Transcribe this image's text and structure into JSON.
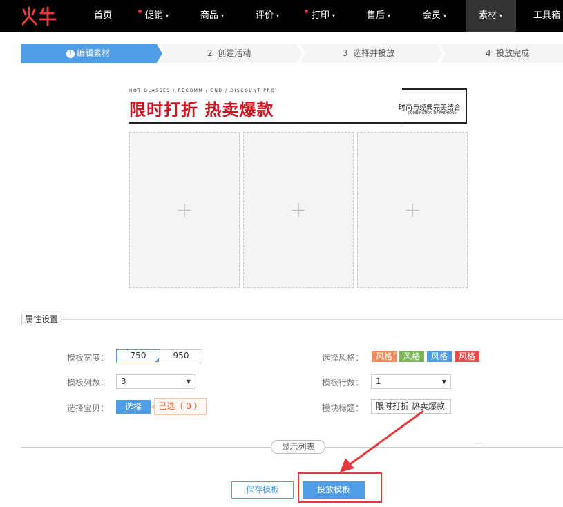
{
  "nav": {
    "items": [
      {
        "label": "首页",
        "has_dot": false,
        "has_caret": false
      },
      {
        "label": "促销",
        "has_dot": true,
        "has_caret": true
      },
      {
        "label": "商品",
        "has_dot": false,
        "has_caret": true
      },
      {
        "label": "评价",
        "has_dot": false,
        "has_caret": true
      },
      {
        "label": "打印",
        "has_dot": true,
        "has_caret": true
      },
      {
        "label": "售后",
        "has_dot": false,
        "has_caret": true
      },
      {
        "label": "会员",
        "has_dot": false,
        "has_caret": true
      },
      {
        "label": "素材",
        "has_dot": false,
        "has_caret": true,
        "active": true
      },
      {
        "label": "工具箱",
        "has_dot": false,
        "has_caret": false
      }
    ],
    "caret": "▾",
    "logo_icon": "huoniu-logo-icon"
  },
  "steps": [
    {
      "num": "1",
      "label": "编辑素材",
      "active": true
    },
    {
      "num": "2",
      "label": "创建活动",
      "active": false
    },
    {
      "num": "3",
      "label": "选择并投放",
      "active": false
    },
    {
      "num": "4",
      "label": "投放完成",
      "active": false
    }
  ],
  "banner": {
    "small": "HOT GLASSES / RECOMM / END / DISCOUNT PRO",
    "title": "限时打折 热卖爆款",
    "sub1": "时尚与经典完美结合",
    "sub2": "COMBINATION OF FASHION+"
  },
  "slots": {
    "plus": "+"
  },
  "properties": {
    "section_title": "属性设置",
    "width_label": "模板宽度：",
    "width_options": [
      "750",
      "950"
    ],
    "columns_label": "模板列数：",
    "columns_value": "3",
    "pick_label": "选择宝贝：",
    "pick_button": "选择",
    "selected_text": "已选（ 0 ）",
    "style_label": "选择风格：",
    "styles": [
      {
        "label": "风格",
        "color": "#f08a5d",
        "selected": true
      },
      {
        "label": "风格",
        "color": "#7cb55a",
        "selected": false
      },
      {
        "label": "风格",
        "color": "#4e9de5",
        "selected": false
      },
      {
        "label": "风格",
        "color": "#e84b4b",
        "selected": false
      }
    ],
    "rows_label": "模板行数：",
    "rows_value": "1",
    "title_label": "模块标题：",
    "title_value": "限时打折 热卖爆款"
  },
  "list_button": "显示列表",
  "save_button": "保存模板",
  "publish_button": "投放模板",
  "colors": {
    "accent": "#4e9de5",
    "annotation": "#e4393c"
  }
}
